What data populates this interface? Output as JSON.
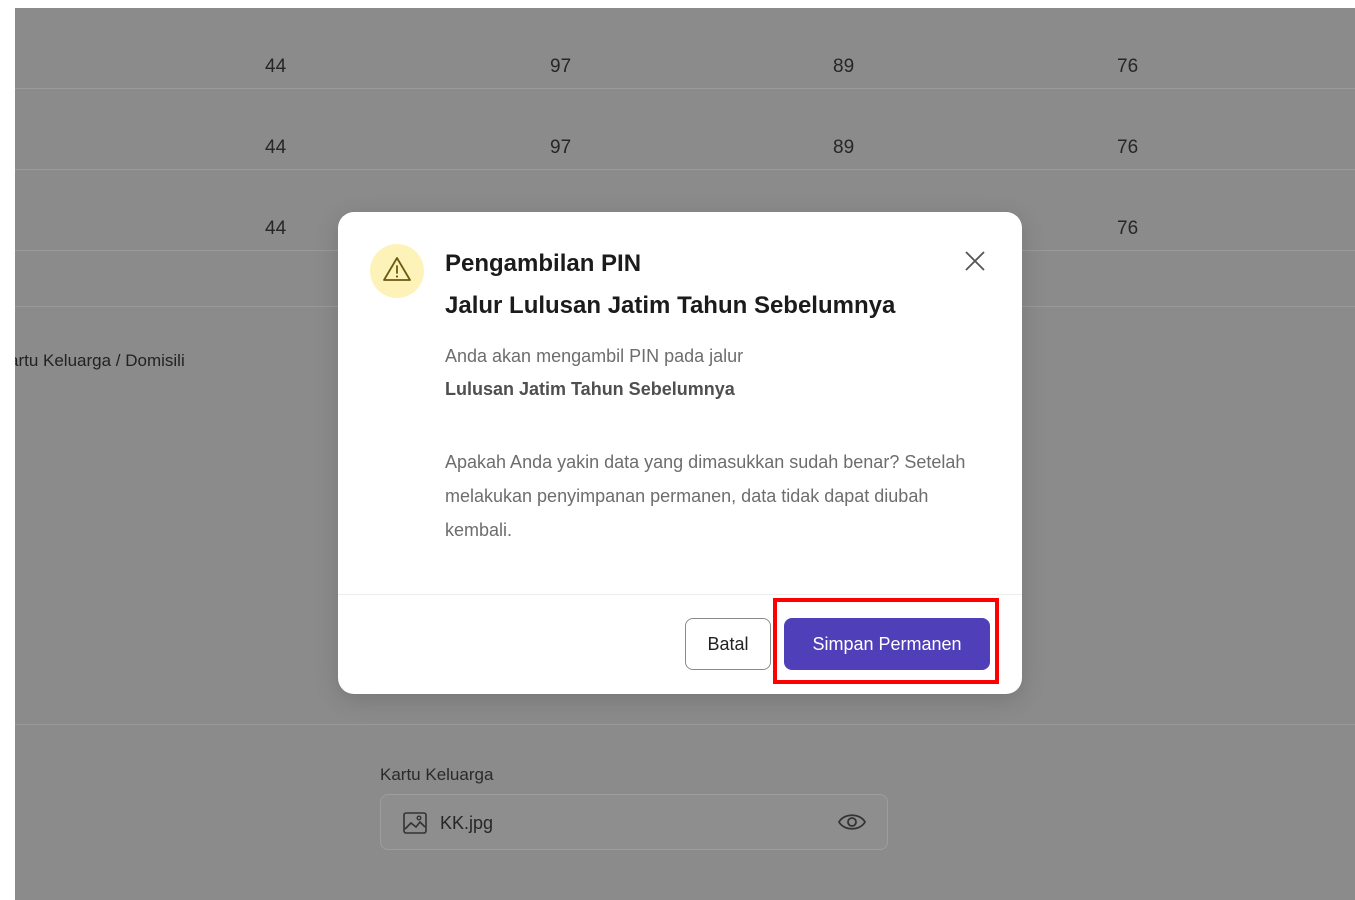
{
  "table": {
    "rows": [
      [
        "44",
        "97",
        "89",
        "76"
      ],
      [
        "44",
        "97",
        "89",
        "76"
      ],
      [
        "44",
        "",
        "",
        "76"
      ]
    ]
  },
  "background": {
    "side_label": "artu Keluarga / Domisili",
    "document": {
      "label": "Kartu Keluarga",
      "filename": "KK.jpg"
    }
  },
  "modal": {
    "title_line1": "Pengambilan PIN",
    "title_line2": "Jalur Lulusan Jatim Tahun Sebelumnya",
    "desc_line1": "Anda akan mengambil PIN pada jalur",
    "desc_line2": "Lulusan Jatim Tahun Sebelumnya",
    "confirm_text": "Apakah Anda yakin data yang dimasukkan sudah benar? Setelah melakukan penyimpanan permanen, data tidak dapat diubah kembali.",
    "cancel_label": "Batal",
    "save_label": "Simpan Permanen"
  },
  "colors": {
    "overlay": "#8b8b8b",
    "primary_button": "#4f3fb8",
    "warning_bg": "#fdf3b9",
    "highlight": "#ff0000"
  },
  "icons": {
    "warning": "warning-triangle-icon",
    "close": "close-icon",
    "image": "image-icon",
    "eye": "eye-icon"
  }
}
